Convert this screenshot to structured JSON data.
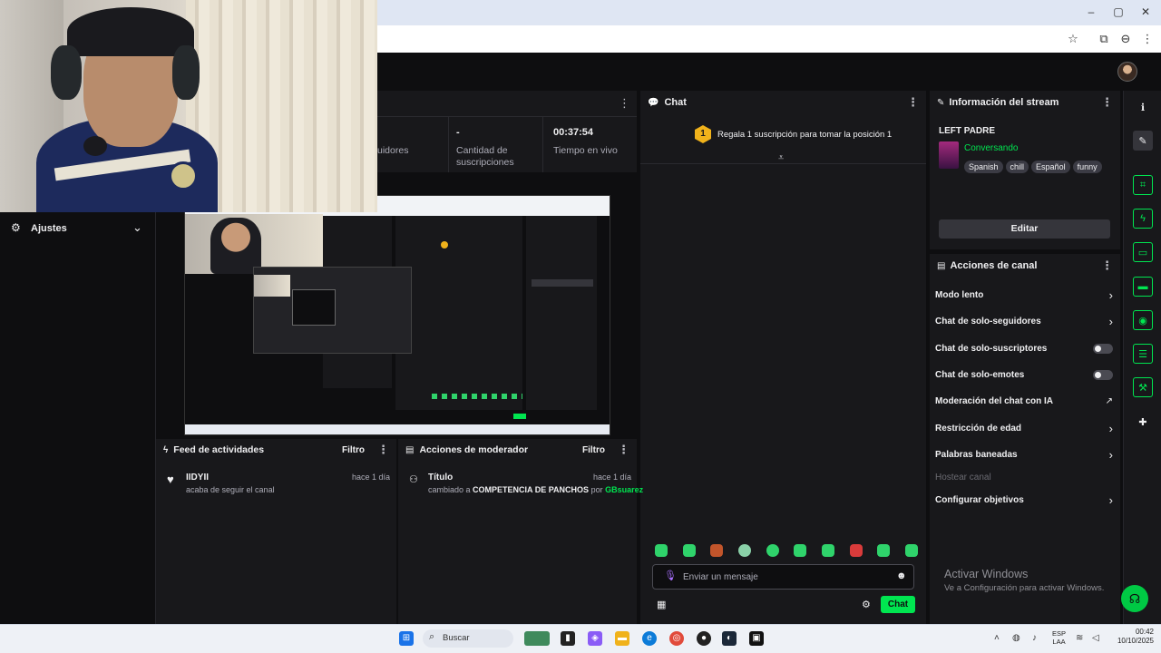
{
  "window": {
    "minimize": "–",
    "maximize": "▢",
    "close": "✕"
  },
  "address_bar": {
    "star": "☆",
    "ext": "⧉",
    "profile": "⊖",
    "menu": "⋮"
  },
  "settings_panel": {
    "label": "Ajustes"
  },
  "stats": {
    "followers_label_partial": "uidores",
    "subs_value": "-",
    "subs_label": "Cantidad de suscripciones",
    "live_time_value": "00:37:54",
    "live_time_label": "Tiempo en vivo"
  },
  "chat": {
    "title": "Chat",
    "banner_rank": "1",
    "banner_text": "Regala 1 suscripción para tomar la posición 1",
    "input_placeholder": "Enviar un mensaje",
    "send_label": "Chat"
  },
  "stream_info": {
    "title": "Información del stream",
    "stream_title": "LEFT PADRE",
    "category": "Conversando",
    "tags": [
      "Spanish",
      "chill",
      "Español",
      "funny"
    ],
    "edit_label": "Editar"
  },
  "channel_actions": {
    "title": "Acciones de canal",
    "items": [
      {
        "label": "Modo lento",
        "control": "chevron"
      },
      {
        "label": "Chat de solo-seguidores",
        "control": "chevron"
      },
      {
        "label": "Chat de solo-suscriptores",
        "control": "toggle"
      },
      {
        "label": "Chat de solo-emotes",
        "control": "toggle"
      },
      {
        "label": "Moderación del chat con IA",
        "control": "external"
      },
      {
        "label": "Restricción de edad",
        "control": "chevron"
      },
      {
        "label": "Palabras baneadas",
        "control": "chevron"
      },
      {
        "label": "Hostear canal",
        "control": "none",
        "disabled": true
      },
      {
        "label": "Configurar objetivos",
        "control": "chevron"
      }
    ]
  },
  "activity_feed": {
    "title": "Feed de actividades",
    "filter": "Filtro",
    "items": [
      {
        "user": "IIDYII",
        "time": "hace 1 día",
        "text": "acaba de seguir el canal"
      }
    ]
  },
  "mod_actions": {
    "title": "Acciones de moderador",
    "filter": "Filtro",
    "items": [
      {
        "title": "Título",
        "time": "hace 1 día",
        "prefix": "cambiado a",
        "value": "COMPETENCIA DE PANCHOS",
        "by": "por",
        "mod": "GBsuarez"
      }
    ]
  },
  "watermark": {
    "title": "Activar Windows",
    "subtitle": "Ve a Configuración para activar Windows."
  },
  "taskbar": {
    "search": "Buscar",
    "lang": "ESP",
    "lang2": "LAA",
    "time": "00:42",
    "date": "10/10/2025"
  },
  "colors": {
    "accent": "#00e550",
    "bg": "#0e0e10",
    "panel": "#18181b"
  }
}
